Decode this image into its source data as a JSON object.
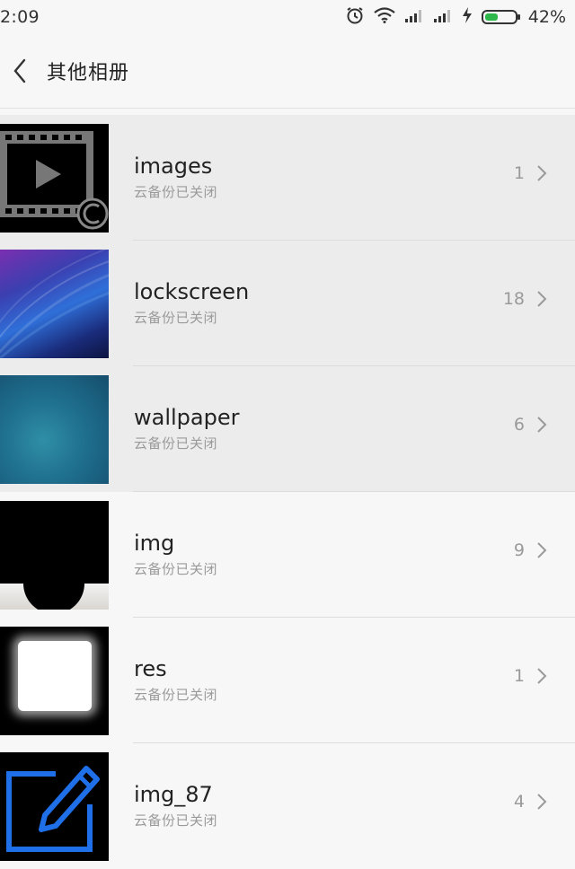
{
  "status": {
    "time": "2:09",
    "battery": "42%",
    "icons": [
      "alarm-icon",
      "wifi-icon",
      "signal-icon",
      "signal-icon",
      "charging-icon",
      "battery-icon"
    ],
    "battery_level": 0.42
  },
  "header": {
    "title": "其他相册",
    "back_icon": "chevron-left-icon"
  },
  "albums": [
    {
      "name": "images",
      "subtitle": "云备份已关闭",
      "count": "1"
    },
    {
      "name": "lockscreen",
      "subtitle": "云备份已关闭",
      "count": "18"
    },
    {
      "name": "wallpaper",
      "subtitle": "云备份已关闭",
      "count": "6"
    },
    {
      "name": "img",
      "subtitle": "云备份已关闭",
      "count": "9"
    },
    {
      "name": "res",
      "subtitle": "云备份已关闭",
      "count": "1"
    },
    {
      "name": "img_87",
      "subtitle": "云备份已关闭",
      "count": "4"
    }
  ],
  "colors": {
    "background": "#f7f7f7",
    "highlight_row": "#ececec",
    "battery_fill": "#2eb84b",
    "secondary_text": "#9a9a9a",
    "edit_icon_blue": "#1e6fe8"
  }
}
